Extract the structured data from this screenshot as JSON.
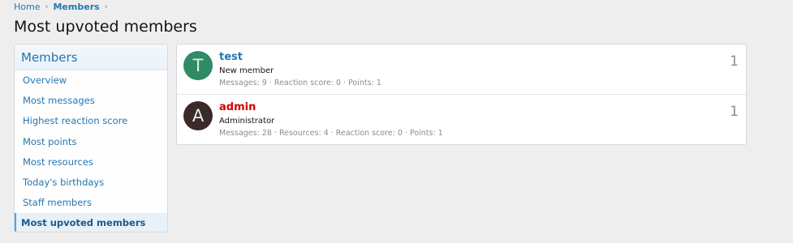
{
  "breadcrumb": {
    "home": "Home",
    "current": "Members",
    "separator": "›"
  },
  "page": {
    "title": "Most upvoted members"
  },
  "sidebar": {
    "header": "Members",
    "items": [
      {
        "label": "Overview"
      },
      {
        "label": "Most messages"
      },
      {
        "label": "Highest reaction score"
      },
      {
        "label": "Most points"
      },
      {
        "label": "Most resources"
      },
      {
        "label": "Today's birthdays"
      },
      {
        "label": "Staff members"
      },
      {
        "label": "Most upvoted members",
        "active": true
      }
    ]
  },
  "members": [
    {
      "avatar_letter": "T",
      "avatar_color": "#2e8b63",
      "name": "test",
      "name_color": "#2577b1",
      "title": "New member",
      "stats": "Messages: 9 · Reaction score: 0 · Points: 1",
      "count": "1"
    },
    {
      "avatar_letter": "A",
      "avatar_color": "#3a2a2a",
      "name": "admin",
      "name_color": "#d40000",
      "title": "Administrator",
      "stats": "Messages: 28 · Resources: 4 · Reaction score: 0 · Points: 1",
      "count": "1"
    }
  ],
  "colors": {
    "link": "#2577b1",
    "page_bg": "#eeeeee",
    "active_border": "#47a7eb"
  }
}
